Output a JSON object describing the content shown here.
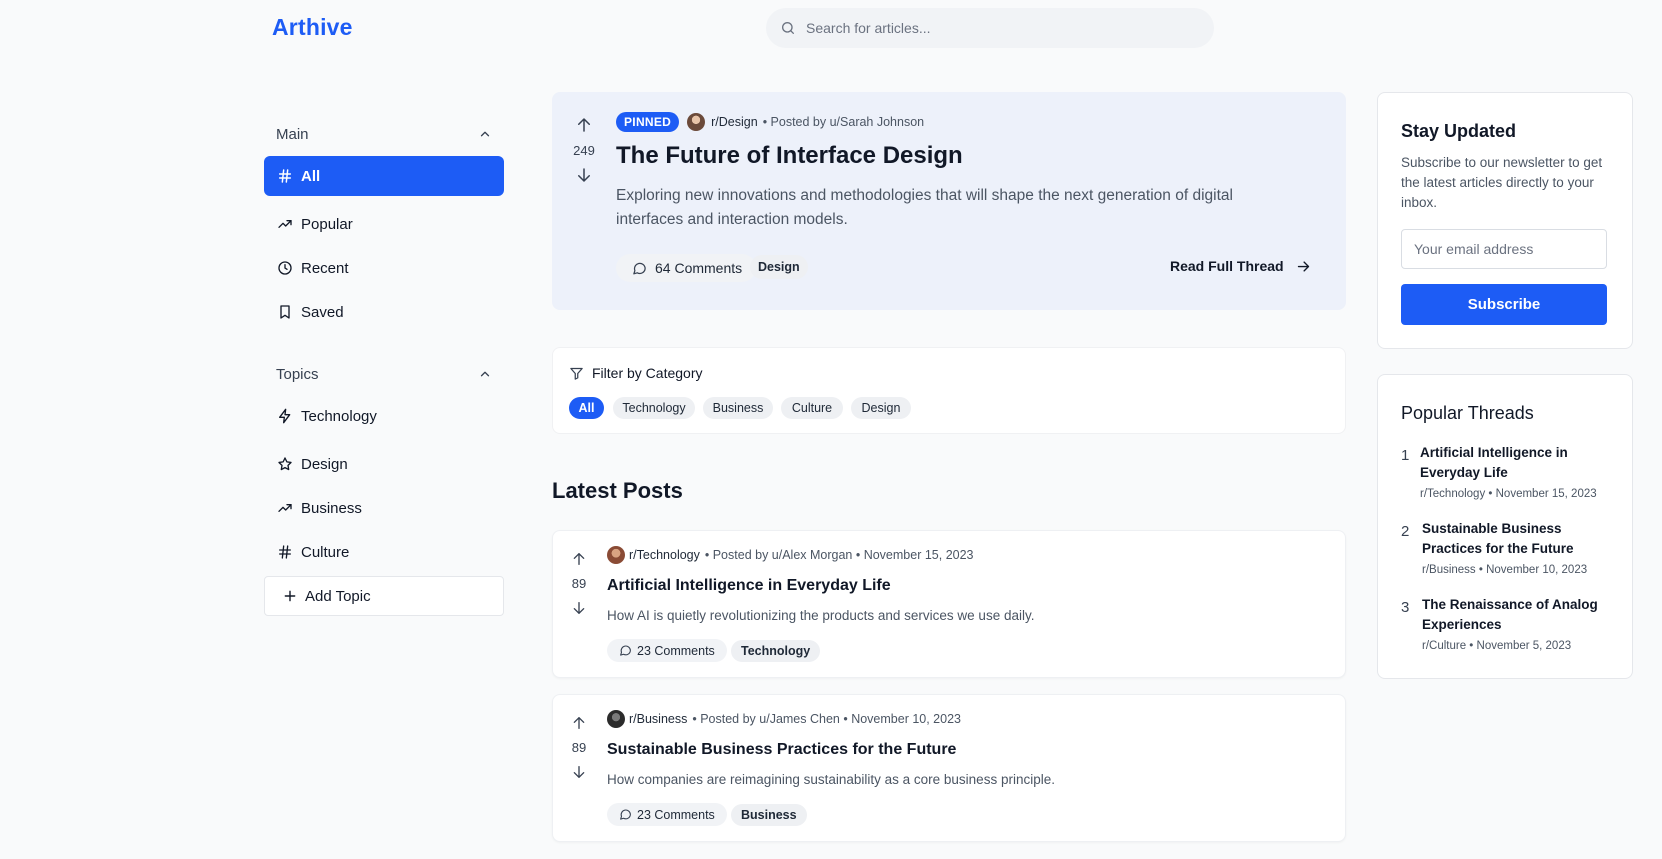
{
  "header": {
    "logo": "Arthive",
    "search_placeholder": "Search for articles..."
  },
  "sidebar": {
    "main_label": "Main",
    "main_items": [
      {
        "label": "All",
        "icon": "hash-icon",
        "active": true
      },
      {
        "label": "Popular",
        "icon": "trending-up-icon"
      },
      {
        "label": "Recent",
        "icon": "clock-icon"
      },
      {
        "label": "Saved",
        "icon": "bookmark-icon"
      }
    ],
    "topics_label": "Topics",
    "topic_items": [
      {
        "label": "Technology",
        "icon": "zap-icon"
      },
      {
        "label": "Design",
        "icon": "star-icon"
      },
      {
        "label": "Business",
        "icon": "trending-up-icon"
      },
      {
        "label": "Culture",
        "icon": "hash-icon"
      }
    ],
    "add_topic": "Add Topic"
  },
  "pinned": {
    "badge": "PINNED",
    "subreddit": "r/Design",
    "posted_by": "• Posted by u/Sarah Johnson",
    "votes": "249",
    "title": "The Future of Interface Design",
    "excerpt": "Exploring new innovations and methodologies that will shape the next generation of digital interfaces and interaction models.",
    "comments": "64 Comments",
    "tag": "Design",
    "read_more": "Read Full Thread"
  },
  "filter": {
    "label": "Filter by Category",
    "chips": [
      "All",
      "Technology",
      "Business",
      "Culture",
      "Design"
    ]
  },
  "latest": {
    "heading": "Latest Posts",
    "posts": [
      {
        "subreddit": "r/Technology",
        "meta": "• Posted by u/Alex Morgan • November 15, 2023",
        "votes": "89",
        "title": "Artificial Intelligence in Everyday Life",
        "excerpt": "How AI is quietly revolutionizing the products and services we use daily.",
        "comments": "23 Comments",
        "tag": "Technology"
      },
      {
        "subreddit": "r/Business",
        "meta": "• Posted by u/James Chen • November 10, 2023",
        "votes": "89",
        "title": "Sustainable Business Practices for the Future",
        "excerpt": "How companies are reimagining sustainability as a core business principle.",
        "comments": "23 Comments",
        "tag": "Business"
      }
    ]
  },
  "newsletter": {
    "title": "Stay Updated",
    "text": "Subscribe to our newsletter to get the latest articles directly to your inbox.",
    "email_placeholder": "Your email address",
    "button": "Subscribe"
  },
  "popular": {
    "title": "Popular Threads",
    "items": [
      {
        "rank": "1",
        "title": "Artificial Intelligence in Everyday Life",
        "meta": "r/Technology • November 15, 2023"
      },
      {
        "rank": "2",
        "title": "Sustainable Business Practices for the Future",
        "meta": "r/Business • November 10, 2023"
      },
      {
        "rank": "3",
        "title": "The Renaissance of Analog Experiences",
        "meta": "r/Culture • November 5, 2023"
      }
    ]
  },
  "colors": {
    "accent": "#1d5cf5",
    "pinned_bg": "#edf1fa",
    "page_bg": "#f9fafb"
  }
}
